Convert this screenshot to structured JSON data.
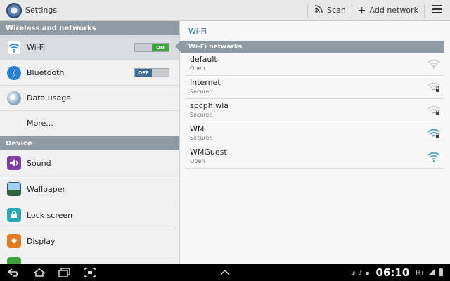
{
  "actionbar": {
    "title": "Settings",
    "scan_label": "Scan",
    "add_network_label": "Add network"
  },
  "left": {
    "sections": [
      {
        "header": "Wireless and networks",
        "items": [
          {
            "label": "Wi-Fi",
            "toggle": "ON"
          },
          {
            "label": "Bluetooth",
            "toggle": "OFF"
          },
          {
            "label": "Data usage"
          },
          {
            "label": "More..."
          }
        ]
      },
      {
        "header": "Device",
        "items": [
          {
            "label": "Sound"
          },
          {
            "label": "Wallpaper"
          },
          {
            "label": "Lock screen"
          },
          {
            "label": "Display"
          }
        ]
      }
    ]
  },
  "right": {
    "title": "Wi-Fi",
    "list_header": "Wi-Fi networks",
    "networks": [
      {
        "name": "default",
        "status": "Open"
      },
      {
        "name": "Internet",
        "status": "Secured"
      },
      {
        "name": "spcph.wla",
        "status": "Secured"
      },
      {
        "name": "WM",
        "status": "Secured"
      },
      {
        "name": "WMGuest",
        "status": "Open"
      }
    ]
  },
  "statusbar": {
    "time": "06:10",
    "network_type": "H+"
  },
  "colors": {
    "accent": "#2f6f8f",
    "section_header": "#8f9aa3",
    "toggle_on": "#3fa23f",
    "toggle_off": "#3d6f99"
  }
}
